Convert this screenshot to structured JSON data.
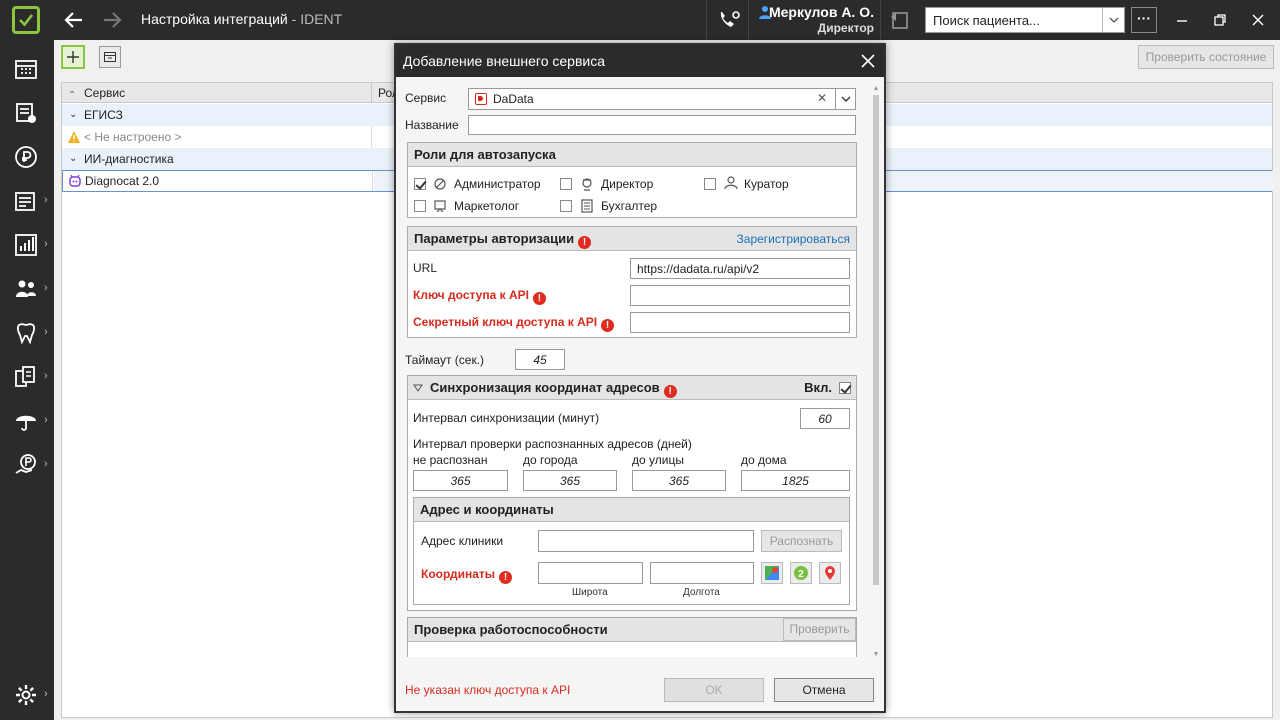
{
  "window": {
    "title": "Настройка интеграций",
    "app_name": "IDENT",
    "title_separator": " - ",
    "user_name": "Меркулов А. О.",
    "user_role": "Директор",
    "search_placeholder": "Поиск пациента...",
    "more_label": "···"
  },
  "toolbar": {
    "check_status_label": "Проверить состояние"
  },
  "grid": {
    "columns": [
      "Сервис",
      "Рол"
    ],
    "rows": [
      {
        "type": "group",
        "label": "ЕГИСЗ"
      },
      {
        "type": "item",
        "label": "< Не настроено >",
        "icon": "warning-icon"
      },
      {
        "type": "group",
        "label": "ИИ-диагностика"
      },
      {
        "type": "item",
        "label": "Diagnocat 2.0",
        "icon": "robot-icon",
        "selected": true
      }
    ]
  },
  "dialog": {
    "title": "Добавление внешнего сервиса",
    "service_label": "Сервис",
    "service_value": "DaData",
    "name_label": "Название",
    "name_value": "",
    "roles": {
      "title": "Роли для автозапуска",
      "items": [
        {
          "label": "Администратор",
          "checked": true,
          "icon": "admin-icon"
        },
        {
          "label": "Директор",
          "checked": false,
          "icon": "director-icon"
        },
        {
          "label": "Куратор",
          "checked": false,
          "icon": "curator-icon"
        },
        {
          "label": "Маркетолог",
          "checked": false,
          "icon": "marketer-icon"
        },
        {
          "label": "Бухгалтер",
          "checked": false,
          "icon": "accountant-icon"
        }
      ]
    },
    "auth": {
      "title": "Параметры авторизации",
      "register_link": "Зарегистрироваться",
      "url_label": "URL",
      "url_value": "https://dadata.ru/api/v2",
      "api_key_label": "Ключ доступа к API",
      "api_key_value": "",
      "secret_key_label": "Секретный ключ доступа к API",
      "secret_key_value": ""
    },
    "timeout": {
      "label": "Таймаут (сек.)",
      "value": "45"
    },
    "sync": {
      "title": "Синхронизация координат адресов",
      "enabled_label": "Вкл.",
      "enabled": true,
      "interval_label": "Интервал синхронизации (минут)",
      "interval_value": "60",
      "check_interval_label": "Интервал проверки распознанных адресов (дней)",
      "checks": [
        {
          "label": "не распознан",
          "value": "365"
        },
        {
          "label": "до города",
          "value": "365"
        },
        {
          "label": "до улицы",
          "value": "365"
        },
        {
          "label": "до дома",
          "value": "1825"
        }
      ],
      "address": {
        "title": "Адрес и координаты",
        "clinic_label": "Адрес клиники",
        "clinic_value": "",
        "recognize_label": "Распознать",
        "coords_label": "Координаты",
        "lat_label": "Широта",
        "lon_label": "Долгота",
        "lat_value": "",
        "lon_value": ""
      }
    },
    "health": {
      "title": "Проверка работоспособности",
      "check_label": "Проверить"
    },
    "error_text": "Не указан ключ доступа к API",
    "ok_label": "OK",
    "cancel_label": "Отмена"
  },
  "colors": {
    "accent": "#8cc63f",
    "error": "#d52b1e",
    "link": "#1d6fb8",
    "dark": "#2b2b2b"
  }
}
